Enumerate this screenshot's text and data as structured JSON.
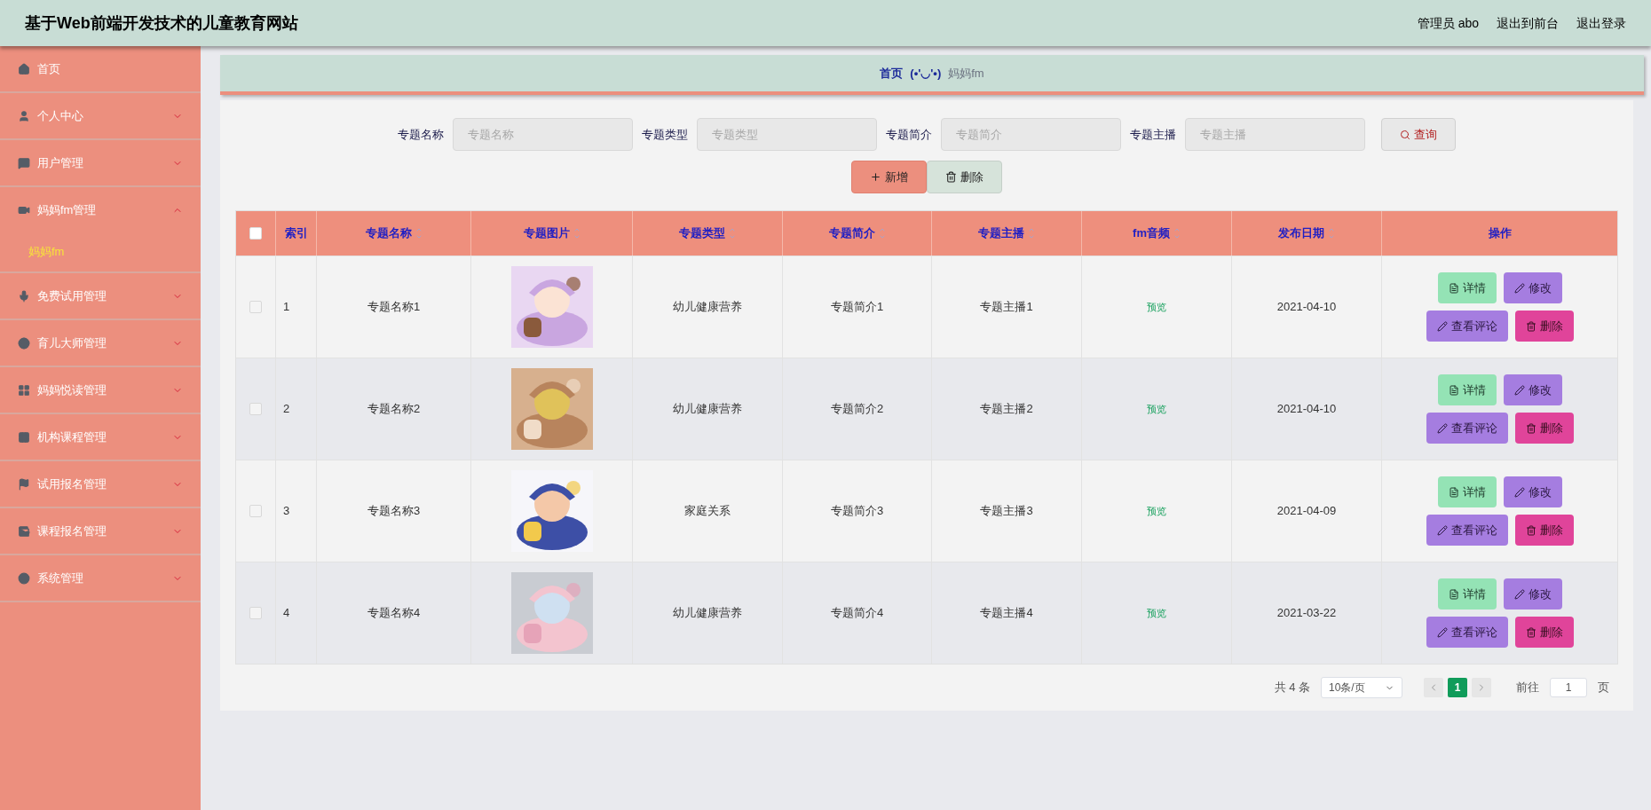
{
  "header": {
    "title": "基于Web前端开发技术的儿童教育网站",
    "links": [
      "管理员 abo",
      "退出到前台",
      "退出登录"
    ]
  },
  "sidebar": {
    "items": [
      {
        "label": "首页",
        "expandable": false
      },
      {
        "label": "个人中心",
        "expandable": true,
        "expanded": false
      },
      {
        "label": "用户管理",
        "expandable": true,
        "expanded": false
      },
      {
        "label": "妈妈fm管理",
        "expandable": true,
        "expanded": true,
        "children": [
          {
            "label": "妈妈fm",
            "selected": true
          }
        ]
      },
      {
        "label": "免费试用管理",
        "expandable": true,
        "expanded": false
      },
      {
        "label": "育儿大师管理",
        "expandable": true,
        "expanded": false
      },
      {
        "label": "妈妈悦读管理",
        "expandable": true,
        "expanded": false
      },
      {
        "label": "机构课程管理",
        "expandable": true,
        "expanded": false
      },
      {
        "label": "试用报名管理",
        "expandable": true,
        "expanded": false
      },
      {
        "label": "课程报名管理",
        "expandable": true,
        "expanded": false
      },
      {
        "label": "系统管理",
        "expandable": true,
        "expanded": false
      }
    ]
  },
  "breadcrumb": {
    "home": "首页",
    "separator": "(•'◡'•)",
    "current": "妈妈fm"
  },
  "search": {
    "fields": [
      {
        "label": "专题名称",
        "placeholder": "专题名称"
      },
      {
        "label": "专题类型",
        "placeholder": "专题类型"
      },
      {
        "label": "专题简介",
        "placeholder": "专题简介"
      },
      {
        "label": "专题主播",
        "placeholder": "专题主播"
      }
    ],
    "button": "查询"
  },
  "toolbar": [
    {
      "kind": "add",
      "label": "新增"
    },
    {
      "kind": "delete",
      "label": "删除"
    }
  ],
  "table": {
    "header_checked": false,
    "columns": [
      {
        "label": "索引",
        "sortable": false
      },
      {
        "label": "专题名称",
        "sortable": true
      },
      {
        "label": "专题图片",
        "sortable": true
      },
      {
        "label": "专题类型",
        "sortable": true
      },
      {
        "label": "专题简介",
        "sortable": true
      },
      {
        "label": "专题主播",
        "sortable": true
      },
      {
        "label": "fm音频",
        "sortable": true
      },
      {
        "label": "发布日期",
        "sortable": true
      },
      {
        "label": "操作",
        "sortable": false
      }
    ],
    "rows": [
      {
        "checked": false,
        "index": "1",
        "name": "专题名称1",
        "type": "幼儿健康营养",
        "intro": "专题简介1",
        "host": "专题主播1",
        "audio": "预览",
        "date": "2021-04-10",
        "actions": [
          {
            "kind": "detail",
            "label": "详情"
          },
          {
            "kind": "edit",
            "label": "修改"
          },
          {
            "kind": "comments",
            "label": "查看评论"
          },
          {
            "kind": "delete",
            "label": "删除"
          }
        ]
      },
      {
        "checked": false,
        "index": "2",
        "name": "专题名称2",
        "type": "幼儿健康营养",
        "intro": "专题简介2",
        "host": "专题主播2",
        "audio": "预览",
        "date": "2021-04-10",
        "actions": [
          {
            "kind": "detail",
            "label": "详情"
          },
          {
            "kind": "edit",
            "label": "修改"
          },
          {
            "kind": "comments",
            "label": "查看评论"
          },
          {
            "kind": "delete",
            "label": "删除"
          }
        ]
      },
      {
        "checked": false,
        "index": "3",
        "name": "专题名称3",
        "type": "家庭关系",
        "intro": "专题简介3",
        "host": "专题主播3",
        "audio": "预览",
        "date": "2021-04-09",
        "actions": [
          {
            "kind": "detail",
            "label": "详情"
          },
          {
            "kind": "edit",
            "label": "修改"
          },
          {
            "kind": "comments",
            "label": "查看评论"
          },
          {
            "kind": "delete",
            "label": "删除"
          }
        ]
      },
      {
        "checked": false,
        "index": "4",
        "name": "专题名称4",
        "type": "幼儿健康营养",
        "intro": "专题简介4",
        "host": "专题主播4",
        "audio": "预览",
        "date": "2021-03-22",
        "actions": [
          {
            "kind": "detail",
            "label": "详情"
          },
          {
            "kind": "edit",
            "label": "修改"
          },
          {
            "kind": "comments",
            "label": "查看评论"
          },
          {
            "kind": "delete",
            "label": "删除"
          }
        ]
      }
    ]
  },
  "pagination": {
    "total": "共 4 条",
    "page_size": "10条/页",
    "pages": [
      {
        "label": "1",
        "selected": true
      }
    ],
    "goto_label": "前往",
    "goto_value": "1",
    "goto_suffix": "页"
  }
}
